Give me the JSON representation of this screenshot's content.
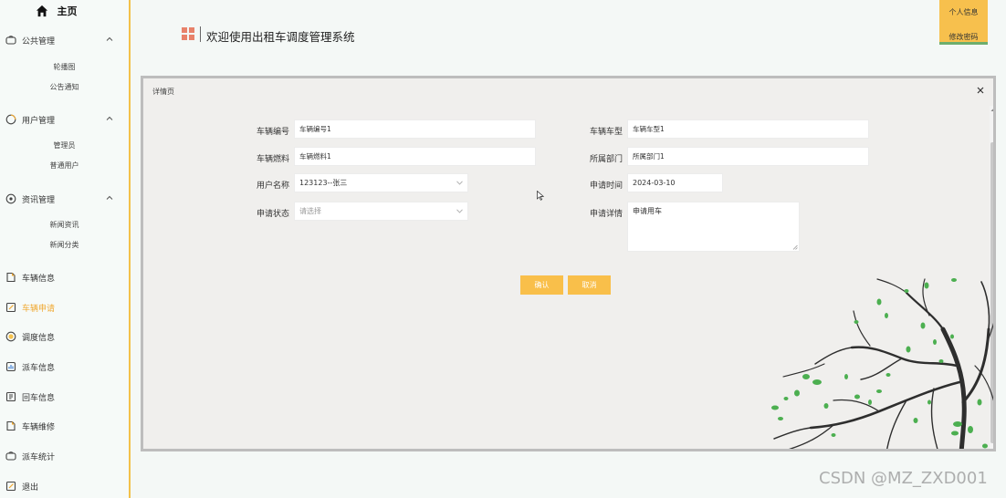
{
  "sidebar": {
    "home": "主页",
    "public": {
      "label": "公共管理",
      "items": [
        "轮播图",
        "公告通知"
      ]
    },
    "users": {
      "label": "用户管理",
      "items": [
        "管理员",
        "普通用户"
      ]
    },
    "news": {
      "label": "资讯管理",
      "items": [
        "新闻资讯",
        "新闻分类"
      ]
    },
    "menu": [
      {
        "label": "车辆信息",
        "icon": "file-icon"
      },
      {
        "label": "车辆申请",
        "icon": "edit-note-icon",
        "active": true
      },
      {
        "label": "调度信息",
        "icon": "dispatch-icon"
      },
      {
        "label": "派车信息",
        "icon": "chart-icon"
      },
      {
        "label": "回车信息",
        "icon": "return-icon"
      },
      {
        "label": "车辆维修",
        "icon": "repair-icon"
      },
      {
        "label": "派车统计",
        "icon": "stats-icon"
      },
      {
        "label": "退出",
        "icon": "logout-icon"
      }
    ]
  },
  "header": {
    "title": "欢迎使用出租车调度管理系统",
    "user_info": "个人信息",
    "change_password": "修改密码"
  },
  "modal": {
    "title": "详情页",
    "fields": {
      "vehicle_no": {
        "label": "车辆编号",
        "value": "车辆编号1"
      },
      "vehicle_type": {
        "label": "车辆车型",
        "value": "车辆车型1"
      },
      "fuel": {
        "label": "车辆燃料",
        "value": "车辆燃料1"
      },
      "department": {
        "label": "所属部门",
        "value": "所属部门1"
      },
      "username": {
        "label": "用户名称",
        "value": "123123--张三"
      },
      "apply_time": {
        "label": "申请时间",
        "value": "2024-03-10"
      },
      "status": {
        "label": "申请状态",
        "placeholder": "请选择"
      },
      "detail": {
        "label": "申请详情",
        "value": "申请用车"
      }
    },
    "confirm": "确认",
    "cancel": "取消"
  },
  "watermark": "CSDN @MZ_ZXD001",
  "colors": {
    "accent": "#f9bf4a",
    "sidebar_border": "#f3c14a",
    "active_text": "#f0a830",
    "tree_leaf": "#4caf50"
  }
}
